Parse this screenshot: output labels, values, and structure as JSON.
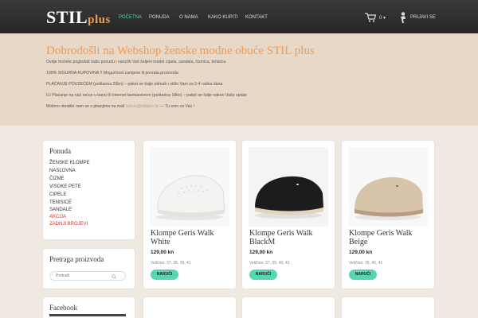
{
  "header": {
    "logo_main": "STIL",
    "logo_sub": "plus",
    "nav": [
      "POČETNA",
      "PONUDA",
      "O NAMA",
      "KAKO KUPITI",
      "KONTAKT"
    ],
    "cart_count": "0 ▾",
    "login": "PRIJAVI SE"
  },
  "welcome": {
    "title": "Dobrodošli na Webshop ženske modne obuće STIL plus",
    "lines": [
      "Ovdje možete pogledati našu ponudu i naručiti Vaš željeni model cipela, sandala, čizmica, tenisica.",
      "100% SIGURNA KUPOVINA !! Mogućnost zamjene ili povrata proizvoda",
      "PLAĆANJE POUZEĆEM (poštarina 29kn) – paket se šalje odmah i stiže Vam za 2-4 radna dana",
      "ILI Plaćanje na naš račun u banci ili internet bankarstvom (poštarina 18kn) – paket se šalje nakon Vaše uplate",
      "Molimo obratite nam se s pitanjima na mail"
    ],
    "mail": "admin@stilplus.hr",
    "mail_suffix": " — Tu smo za Vas !"
  },
  "sidebar": {
    "categories_title": "Ponuda",
    "categories": [
      {
        "label": "ŽENSKE KLOMPE"
      },
      {
        "label": "NASLOVNA"
      },
      {
        "label": "ČIZME"
      },
      {
        "label": "VISOKE PETE"
      },
      {
        "label": "CIPELE"
      },
      {
        "label": "TENISICE"
      },
      {
        "label": "SANDALE"
      },
      {
        "label": "AKCIJA"
      },
      {
        "label": "ZADNJI BROJEVI"
      }
    ],
    "search_title": "Pretraga proizvoda",
    "search_placeholder": "Pretraži",
    "facebook_title": "Facebook"
  },
  "products": [
    {
      "name": "Klompe Geris Walk White",
      "price": "129,00 kn",
      "sizes": "Veličine: 37, 38, 39, 41",
      "button": "NARUČI",
      "color": "#f3f3f1"
    },
    {
      "name": "Klompe Geris Walk BlackM",
      "price": "129,00 kn",
      "sizes": "Veličine: 37, 39, 40, 41",
      "button": "NARUČI",
      "color": "#1c1c1e"
    },
    {
      "name": "Klompe Geris Walk Beige",
      "price": "129,00 kn",
      "sizes": "Veličine: 39, 40, 41",
      "button": "NARUČI",
      "color": "#d8c3ab"
    }
  ],
  "colors": {
    "accent": "#58d6b2",
    "title_orange": "#f09a55",
    "welcome_bg": "#e8d8c7",
    "sale_red": "#d9352b"
  }
}
